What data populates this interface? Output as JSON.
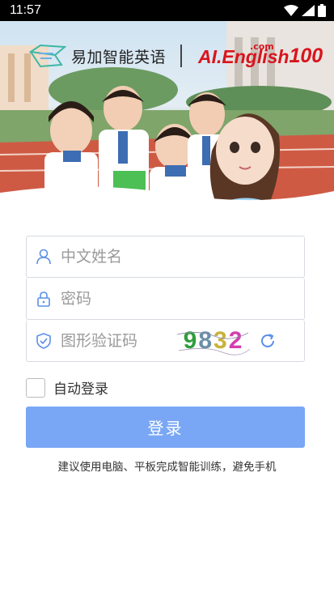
{
  "status_bar": {
    "time": "11:57"
  },
  "brand": {
    "name_cn": "易加智能英语",
    "name_en": "AI.English",
    "name_num": "100",
    "name_com": ".com"
  },
  "login": {
    "name_placeholder": "中文姓名",
    "password_placeholder": "密码",
    "captcha_placeholder": "图形验证码",
    "captcha_digits": [
      "9",
      "8",
      "3",
      "2"
    ],
    "remember_label": "自动登录",
    "submit_label": "登录",
    "tip": "建议使用电脑、平板完成智能训练，避免手机"
  },
  "colors": {
    "button": "#7aa7f5",
    "icon": "#5b8fe8",
    "brand_red": "#d9141e"
  }
}
